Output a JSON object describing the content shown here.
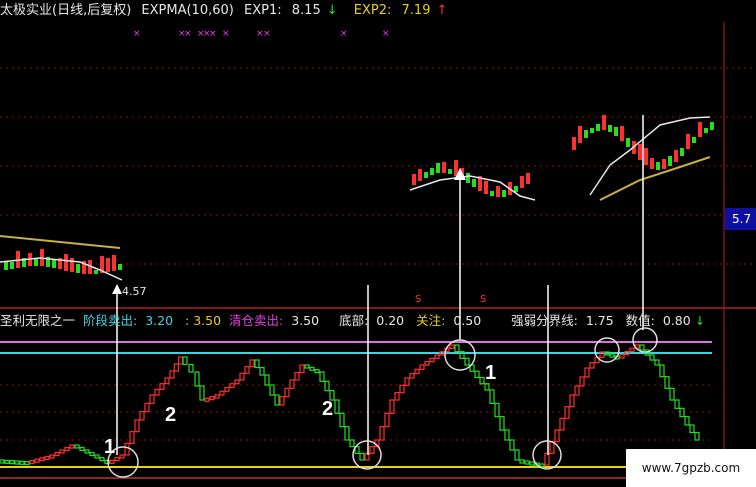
{
  "header": {
    "title": "太极实业(日线,后复权)",
    "indicator": "EXPMA(10,60)",
    "exp1_label": "EXP1:",
    "exp1_value": "8.15",
    "exp1_arrow": "↓",
    "exp2_label": "EXP2:",
    "exp2_value": "7.19",
    "exp2_arrow": "↑"
  },
  "main_chart": {
    "price_label_left": "4.57",
    "price_label_right": "5.7"
  },
  "sub_panel": {
    "name": "圣利无限之一",
    "stage_label": "阶段卖出:",
    "stage_value": "3.20",
    "stage_extra": ": 3.50",
    "clear_label": "清仓卖出:",
    "clear_value": "3.50",
    "bottom_label": "底部:",
    "bottom_value": "0.20",
    "focus_label": "关注:",
    "focus_value": "0.50",
    "strength_label": "强弱分界线:",
    "strength_value": "1.75",
    "value_label": "数值:",
    "value_value": "0.80",
    "value_arrow": "↓"
  },
  "annotations": [
    "1",
    "2",
    "2",
    "1"
  ],
  "watermark": "www.7gpzb.com",
  "colors": {
    "up": "#ff3030",
    "down": "#20e020",
    "exp1": "#e8e8e8",
    "exp2": "#c8b040",
    "level_top": "#e070e0",
    "level_mid": "#3fd3e0",
    "level_bottom": "#e8d020"
  }
}
